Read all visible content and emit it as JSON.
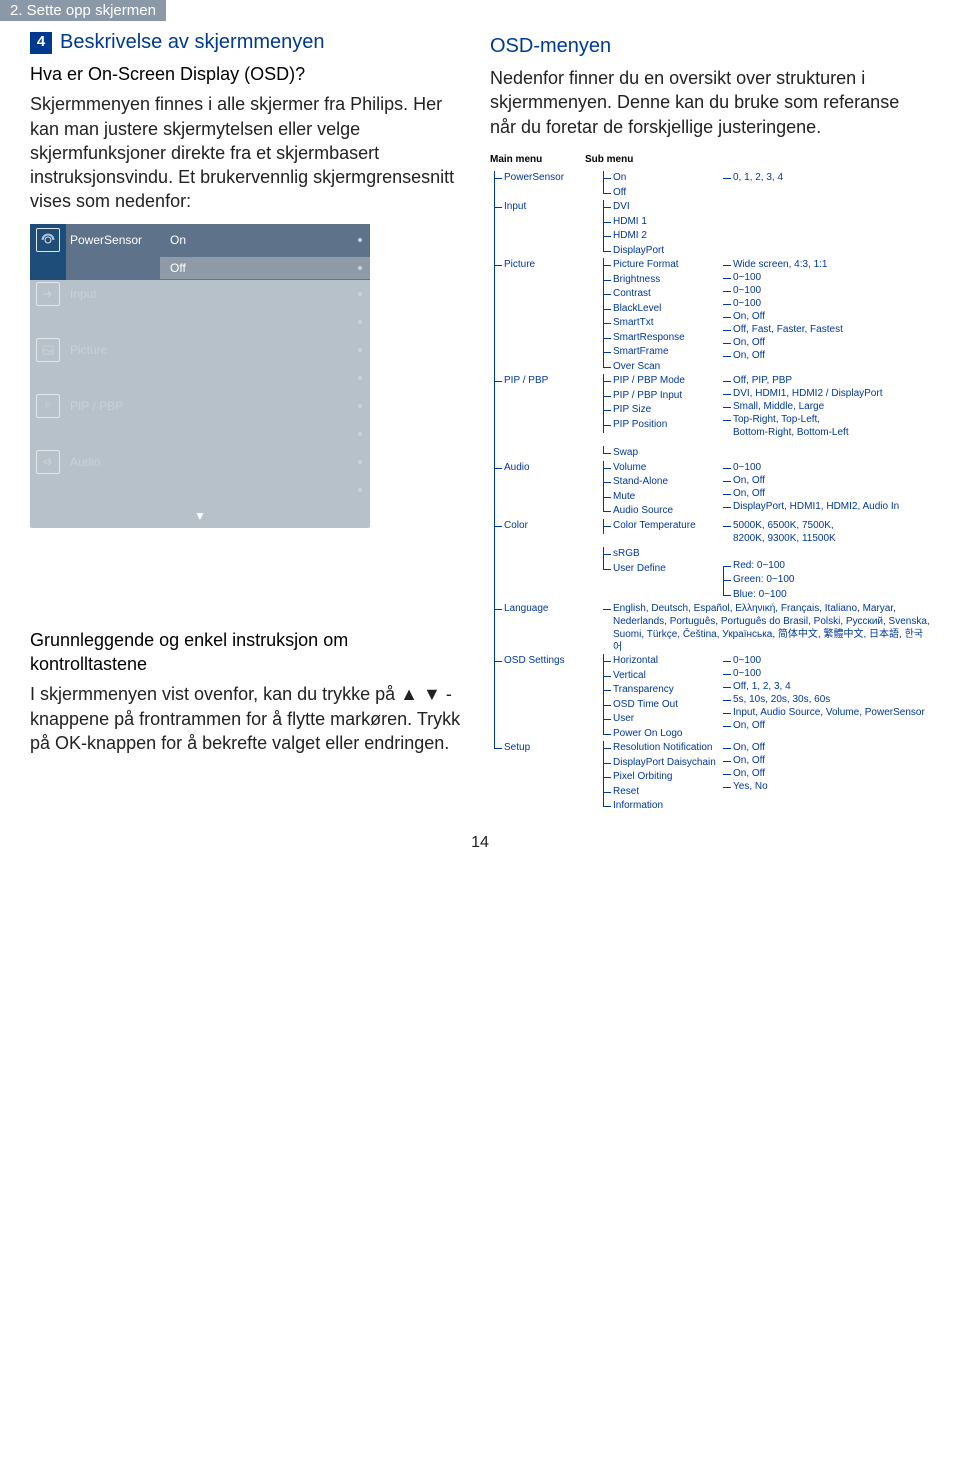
{
  "header_tab": "2. Sette opp skjermen",
  "step": {
    "num": "4",
    "title": "Beskrivelse av skjermmenyen"
  },
  "left": {
    "q": "Hva er On-Screen Display (OSD)?",
    "p1": "Skjermmenyen finnes i alle skjermer fra Philips. Her kan man justere skjermytelsen eller velge skjermfunksjoner direkte fra et skjermbasert instruksjonsvindu. Et brukervennlig skjermgrensesnitt vises som nedenfor:",
    "h2": "Grunnleggende og enkel instruksjon om kontrolltastene",
    "p2a": "I skjermmenyen vist ovenfor, kan du trykke på ",
    "p2arrows": "▲ ▼",
    "p2b": " -knappene på frontrammen for å flytte markøren. Trykk på ",
    "ok": "OK",
    "p2c": "-knappen for å bekrefte valget eller endringen."
  },
  "osd_shot": {
    "items": [
      {
        "icon": "sensor",
        "label": "PowerSensor"
      },
      {
        "icon": "input",
        "label": "Input"
      },
      {
        "icon": "pic",
        "label": "Picture"
      },
      {
        "icon": "pip",
        "label": "PIP / PBP"
      },
      {
        "icon": "audio",
        "label": "Audio"
      }
    ],
    "opt_on": "On",
    "opt_off": "Off"
  },
  "right": {
    "title": "OSD-menyen",
    "intro": "Nedenfor finner du en oversikt over strukturen i skjermmenyen. Denne kan du bruke som referanse når du foretar de forskjellige justeringene."
  },
  "tree": {
    "head_main": "Main menu",
    "head_sub": "Sub menu",
    "menus": [
      {
        "name": "PowerSensor",
        "subs": [
          {
            "name": "On",
            "val": "0, 1, 2, 3, 4"
          },
          {
            "name": "Off"
          }
        ]
      },
      {
        "name": "Input",
        "subs": [
          {
            "name": "DVI"
          },
          {
            "name": "HDMI 1"
          },
          {
            "name": "HDMI 2"
          },
          {
            "name": "DisplayPort"
          }
        ]
      },
      {
        "name": "Picture",
        "subs": [
          {
            "name": "Picture Format",
            "val": "Wide screen, 4:3, 1:1"
          },
          {
            "name": "Brightness",
            "val": "0~100"
          },
          {
            "name": "Contrast",
            "val": "0~100"
          },
          {
            "name": "BlackLevel",
            "val": "0~100"
          },
          {
            "name": "SmartTxt",
            "val": "On, Off"
          },
          {
            "name": "SmartResponse",
            "val": "Off, Fast, Faster, Fastest"
          },
          {
            "name": "SmartFrame",
            "val": "On, Off"
          },
          {
            "name": "Over Scan",
            "val": "On, Off"
          }
        ]
      },
      {
        "name": "PIP / PBP",
        "subs": [
          {
            "name": "PIP / PBP Mode",
            "val": "Off, PIP, PBP"
          },
          {
            "name": "PIP / PBP Input",
            "val": "DVI, HDMI1, HDMI2 / DisplayPort"
          },
          {
            "name": "PIP Size",
            "val": "Small, Middle, Large"
          },
          {
            "name": "PIP Position",
            "val": "Top-Right, Top-Left,\nBottom-Right, Bottom-Left"
          },
          {
            "name": "Swap"
          }
        ]
      },
      {
        "name": "Audio",
        "subs": [
          {
            "name": "Volume",
            "val": "0~100"
          },
          {
            "name": "Stand-Alone",
            "val": "On, Off"
          },
          {
            "name": "Mute",
            "val": "On, Off"
          },
          {
            "name": "Audio Source",
            "val": "DisplayPort, HDMI1, HDMI2, Audio In"
          }
        ]
      },
      {
        "name": "Color",
        "subs": [
          {
            "name": "Color Temperature",
            "val": "5000K, 6500K, 7500K,\n8200K, 9300K, 11500K"
          },
          {
            "name": "sRGB"
          },
          {
            "name": "User Define",
            "vals": [
              "Red: 0~100",
              "Green: 0~100",
              "Blue: 0~100"
            ]
          }
        ]
      },
      {
        "name": "Language",
        "lang": "English, Deutsch, Español, Ελληνική, Français, Italiano, Maryar, Nederlands, Português, Português do Brasil, Polski, Русский, Svenska, Suomi, Türkçe, Čeština, Українська, 简体中文, 繁體中文, 日本語, 한국어"
      },
      {
        "name": "OSD Settings",
        "subs": [
          {
            "name": "Horizontal",
            "val": "0~100"
          },
          {
            "name": "Vertical",
            "val": "0~100"
          },
          {
            "name": "Transparency",
            "val": "Off, 1, 2, 3, 4"
          },
          {
            "name": "OSD Time Out",
            "val": "5s, 10s, 20s, 30s, 60s"
          },
          {
            "name": "User",
            "val": "Input, Audio Source, Volume, PowerSensor"
          },
          {
            "name": "Power On Logo",
            "val": "On, Off"
          }
        ]
      },
      {
        "name": "Setup",
        "subs": [
          {
            "name": "Resolution Notification",
            "val": "On, Off"
          },
          {
            "name": "DisplayPort Daisychain",
            "val": "On, Off"
          },
          {
            "name": "Pixel Orbiting",
            "val": "On, Off"
          },
          {
            "name": "Reset",
            "val": "Yes, No"
          },
          {
            "name": "Information"
          }
        ]
      }
    ]
  },
  "page_num": "14"
}
